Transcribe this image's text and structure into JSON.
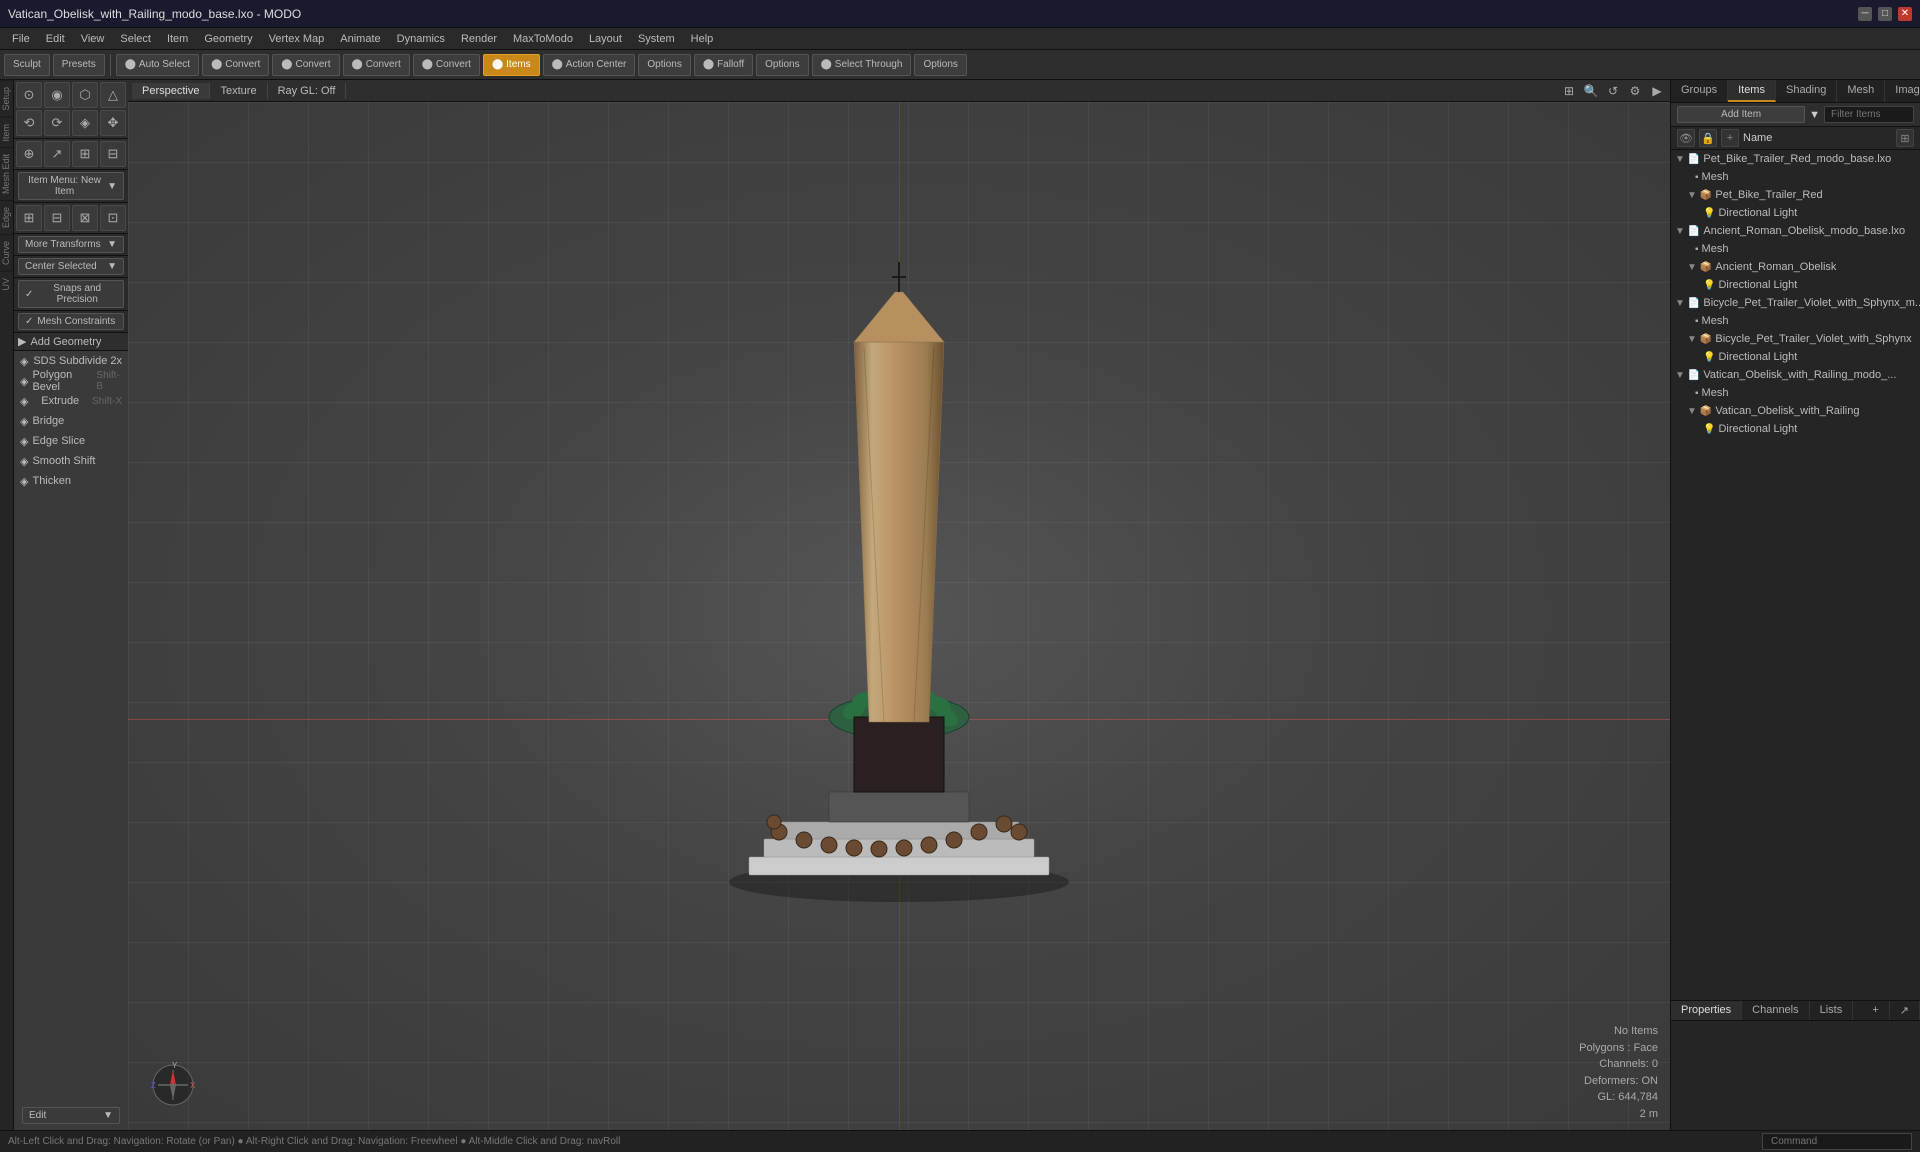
{
  "titleBar": {
    "title": "Vatican_Obelisk_with_Railing_modo_base.lxo - MODO",
    "minBtn": "─",
    "maxBtn": "□",
    "closeBtn": "✕"
  },
  "menuBar": {
    "items": [
      "File",
      "Edit",
      "View",
      "Select",
      "Item",
      "Geometry",
      "Vertex Map",
      "Animate",
      "Dynamics",
      "Render",
      "MaxToModo",
      "Layout",
      "System",
      "Help"
    ]
  },
  "toolbar": {
    "sculpt_label": "Sculpt",
    "presets_label": "Presets",
    "auto_select_label": "Auto Select",
    "convert1_label": "Convert",
    "convert2_label": "Convert",
    "convert3_label": "Convert",
    "convert4_label": "Convert",
    "items_label": "Items",
    "action_center_label": "Action Center",
    "options1_label": "Options",
    "falloff_label": "Falloff",
    "options2_label": "Options",
    "select_through_label": "Select Through",
    "options3_label": "Options"
  },
  "viewport": {
    "tabs": [
      "Perspective",
      "Texture",
      "Ray GL: Off"
    ],
    "mode": "Perspective"
  },
  "leftPanel": {
    "vLabels": [
      "Setup",
      "Item",
      "Mesh Edit",
      "Edge",
      "Curve",
      "UV"
    ],
    "topIcons": [
      "⊙",
      "◎",
      "⬡",
      "△",
      "⟲",
      "⟳",
      "◈",
      "✥",
      "⊕",
      "↗"
    ],
    "itemMenu": "Item Menu: New Item",
    "transforms": [
      "⊞",
      "⊟",
      "⊠",
      "⊡",
      "⟳",
      "↖",
      "↘"
    ],
    "moreTransforms": "More Transforms",
    "centerSelected": "Center Selected",
    "snapsAndPrecision": "Snaps and Precision",
    "meshConstraints": "Mesh Constraints",
    "addGeometry": "Add Geometry",
    "tools": [
      {
        "name": "SDS Subdivide 2x",
        "shortcut": ""
      },
      {
        "name": "Polygon Bevel",
        "shortcut": "Shift-B"
      },
      {
        "name": "Extrude",
        "shortcut": "Shift-X"
      },
      {
        "name": "Bridge",
        "shortcut": ""
      },
      {
        "name": "Edge Slice",
        "shortcut": ""
      },
      {
        "name": "Smooth Shift",
        "shortcut": ""
      },
      {
        "name": "Thicken",
        "shortcut": ""
      }
    ],
    "editLabel": "Edit"
  },
  "rightPanel": {
    "tabs": [
      "Groups",
      "Items",
      "Shading",
      "Mesh",
      "Images"
    ],
    "addItemBtn": "Add Item",
    "filterPlaceholder": "Filter Items",
    "columnName": "Name",
    "sceneItems": [
      {
        "type": "file",
        "name": "Pet_Bike_Trailer_Red_modo_base.lxo",
        "indent": 0,
        "expanded": true,
        "isGroup": true
      },
      {
        "type": "mesh",
        "name": "Mesh",
        "indent": 1
      },
      {
        "type": "group",
        "name": "Pet_Bike_Trailer_Red",
        "indent": 1,
        "expanded": true
      },
      {
        "type": "light",
        "name": "Directional Light",
        "indent": 2
      },
      {
        "type": "file",
        "name": "Ancient_Roman_Obelisk_modo_base.lxo",
        "indent": 0,
        "expanded": true,
        "isGroup": true
      },
      {
        "type": "mesh",
        "name": "Mesh",
        "indent": 1
      },
      {
        "type": "group",
        "name": "Ancient_Roman_Obelisk",
        "indent": 1,
        "expanded": true
      },
      {
        "type": "light",
        "name": "Directional Light",
        "indent": 2
      },
      {
        "type": "file",
        "name": "Bicycle_Pet_Trailer_Violet_with_Sphynx_m...",
        "indent": 0,
        "expanded": true,
        "isGroup": true
      },
      {
        "type": "mesh",
        "name": "Mesh",
        "indent": 1
      },
      {
        "type": "group",
        "name": "Bicycle_Pet_Trailer_Violet_with_Sphynx",
        "indent": 1,
        "expanded": true
      },
      {
        "type": "light",
        "name": "Directional Light",
        "indent": 2
      },
      {
        "type": "file",
        "name": "Vatican_Obelisk_with_Railing_modo_...",
        "indent": 0,
        "expanded": true,
        "isGroup": true
      },
      {
        "type": "mesh",
        "name": "Mesh",
        "indent": 1
      },
      {
        "type": "group",
        "name": "Vatican_Obelisk_with_Railing",
        "indent": 1,
        "expanded": true
      },
      {
        "type": "light",
        "name": "Directional Light",
        "indent": 2
      }
    ],
    "bottomTabs": [
      "Properties",
      "Channels",
      "Lists"
    ],
    "statusInfo": {
      "label": "No Items",
      "polygons": "Polygons : Face",
      "channels": "Channels: 0",
      "deformers": "Deformers: ON",
      "gl": "GL: 644,784",
      "scale": "2 m"
    }
  },
  "statusBar": {
    "text": "Alt-Left Click and Drag: Navigation: Rotate (or Pan)  ●  Alt-Right Click and Drag: Navigation: Freewheel  ●  Alt-Middle Click and Drag: navRoll",
    "commandPlaceholder": "Command"
  }
}
